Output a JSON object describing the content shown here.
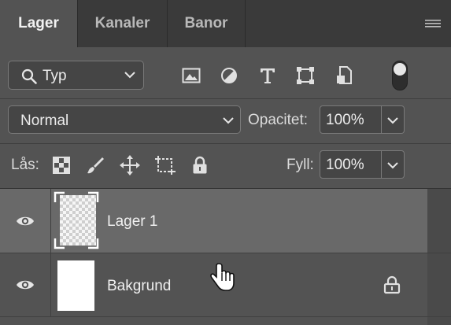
{
  "tabs": [
    {
      "label": "Lager",
      "active": true
    },
    {
      "label": "Kanaler",
      "active": false
    },
    {
      "label": "Banor",
      "active": false
    }
  ],
  "filter": {
    "kind_label": "Typ",
    "icons": [
      "image-filter-icon",
      "adjustment-filter-icon",
      "type-filter-icon",
      "shape-filter-icon",
      "smart-object-filter-icon"
    ]
  },
  "blend": {
    "mode": "Normal",
    "opacity_label": "Opacitet:",
    "opacity_value": "100%"
  },
  "lock": {
    "label": "Lås:",
    "icons": [
      "lock-transparent-pixels-icon",
      "lock-image-pixels-icon",
      "lock-position-icon",
      "prevent-auto-nesting-icon",
      "lock-all-icon"
    ],
    "fill_label": "Fyll:",
    "fill_value": "100%"
  },
  "layers": [
    {
      "name": "Lager 1",
      "visible": true,
      "selected": true,
      "locked": false
    },
    {
      "name": "Bakgrund",
      "visible": true,
      "selected": false,
      "locked": true
    }
  ],
  "colors": {
    "panel": "#535353",
    "tabbar": "#3a3a3a",
    "selected_row": "#696969"
  }
}
